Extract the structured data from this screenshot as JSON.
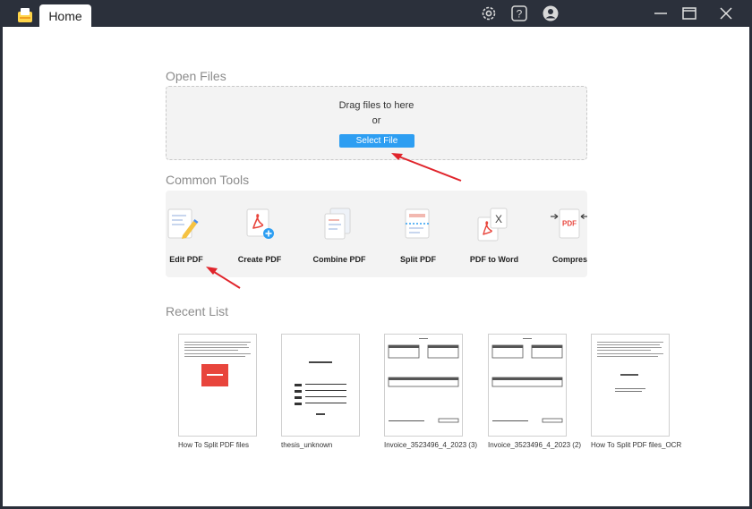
{
  "titlebar": {
    "tab_label": "Home",
    "icons": [
      "app-logo-icon",
      "gear-icon",
      "help-icon",
      "user-avatar-icon",
      "minimize-icon",
      "maximize-icon",
      "close-icon"
    ]
  },
  "open_files": {
    "title": "Open Files",
    "drag_text": "Drag files to here",
    "or_text": "or",
    "select_button": "Select File"
  },
  "common_tools": {
    "title": "Common Tools",
    "items": [
      {
        "label": "Edit PDF",
        "icon": "edit-pdf-icon"
      },
      {
        "label": "Create PDF",
        "icon": "create-pdf-icon"
      },
      {
        "label": "Combine PDF",
        "icon": "combine-pdf-icon"
      },
      {
        "label": "Split PDF",
        "icon": "split-pdf-icon"
      },
      {
        "label": "PDF to Word",
        "icon": "pdf-to-word-icon"
      },
      {
        "label": "Compress",
        "icon": "compress-pdf-icon"
      }
    ]
  },
  "recent": {
    "title": "Recent List",
    "items": [
      {
        "name": "How To Split PDF files"
      },
      {
        "name": "thesis_unknown"
      },
      {
        "name": "Invoice_3523496_4_2023 (3)"
      },
      {
        "name": "Invoice_3523496_4_2023 (2)"
      },
      {
        "name": "How To Split PDF files_OCR"
      }
    ]
  },
  "colors": {
    "titlebar": "#2b303b",
    "accent": "#2d9ef2",
    "annotation_arrow": "#e0242b",
    "pdf_red": "#e8453c"
  }
}
